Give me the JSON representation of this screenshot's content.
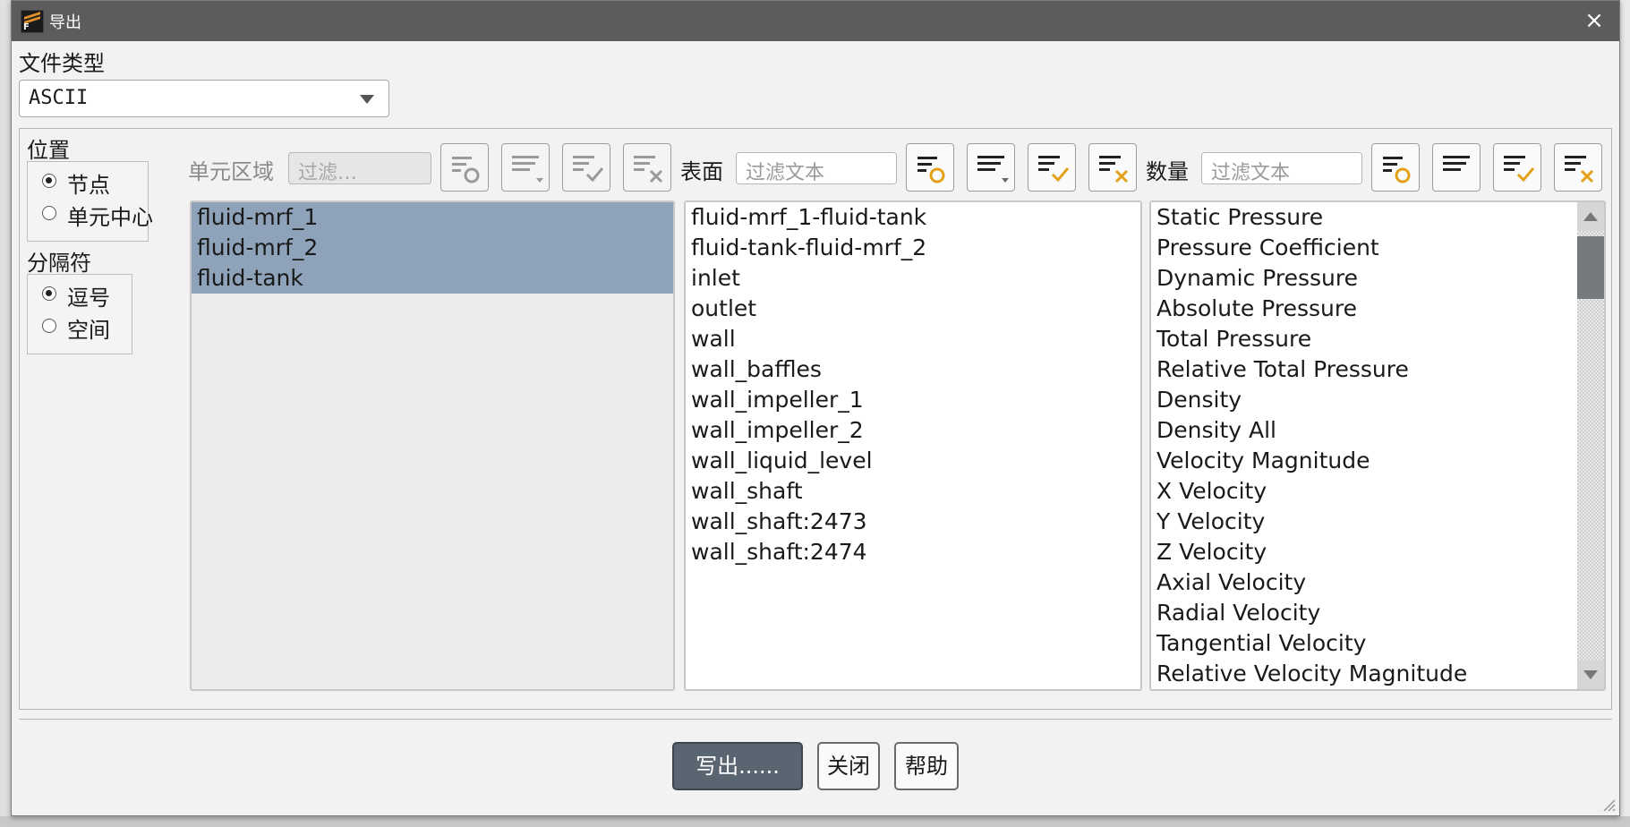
{
  "window": {
    "title": "导出",
    "close_label": "×"
  },
  "file_type": {
    "label": "文件类型",
    "value": "ASCII"
  },
  "location": {
    "label": "位置",
    "options": [
      {
        "label": "节点",
        "selected": true
      },
      {
        "label": "单元中心",
        "selected": false
      }
    ]
  },
  "delimiter": {
    "label": "分隔符",
    "options": [
      {
        "label": "逗号",
        "selected": true
      },
      {
        "label": "空间",
        "selected": false
      }
    ]
  },
  "cell_zones": {
    "label": "单元区域",
    "filter_placeholder": "过滤…",
    "items": [
      {
        "label": "fluid-mrf_1",
        "selected": true
      },
      {
        "label": "fluid-mrf_2",
        "selected": true
      },
      {
        "label": "fluid-tank",
        "selected": true
      }
    ]
  },
  "surfaces": {
    "label": "表面",
    "filter_placeholder": "过滤文本",
    "items": [
      "fluid-mrf_1-fluid-tank",
      "fluid-tank-fluid-mrf_2",
      "inlet",
      "outlet",
      "wall",
      "wall_baffles",
      "wall_impeller_1",
      "wall_impeller_2",
      "wall_liquid_level",
      "wall_shaft",
      "wall_shaft:2473",
      "wall_shaft:2474"
    ]
  },
  "quantities": {
    "label": "数量",
    "filter_placeholder": "过滤文本",
    "items": [
      "Static Pressure",
      "Pressure Coefficient",
      "Dynamic Pressure",
      "Absolute Pressure",
      "Total Pressure",
      "Relative Total Pressure",
      "Density",
      "Density All",
      "Velocity Magnitude",
      "X Velocity",
      "Y Velocity",
      "Z Velocity",
      "Axial Velocity",
      "Radial Velocity",
      "Tangential Velocity",
      "Relative Velocity Magnitude"
    ]
  },
  "buttons": {
    "write": "写出......",
    "close": "关闭",
    "help": "帮助"
  },
  "colors": {
    "titlebar": "#5c5c5c",
    "selection": "#8ea3b9",
    "primary_button": "#5a6572",
    "icon_accent": "#e2a117"
  },
  "icons": {
    "toolbar": [
      "filter-circle-icon",
      "list-dropdown-icon",
      "select-all-check-icon",
      "deselect-all-x-icon"
    ]
  }
}
